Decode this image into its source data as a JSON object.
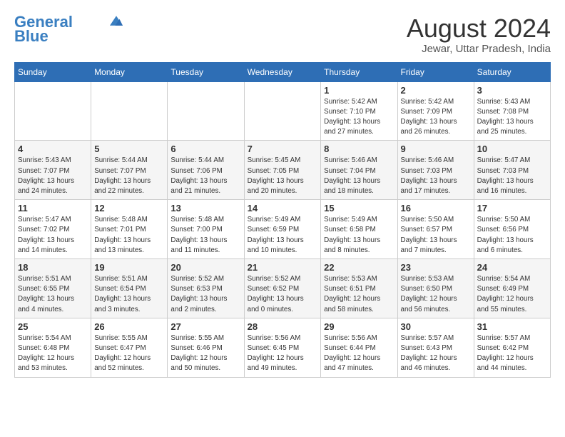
{
  "header": {
    "logo_line1": "General",
    "logo_line2": "Blue",
    "month": "August 2024",
    "location": "Jewar, Uttar Pradesh, India"
  },
  "days_of_week": [
    "Sunday",
    "Monday",
    "Tuesday",
    "Wednesday",
    "Thursday",
    "Friday",
    "Saturday"
  ],
  "weeks": [
    [
      {
        "day": "",
        "info": ""
      },
      {
        "day": "",
        "info": ""
      },
      {
        "day": "",
        "info": ""
      },
      {
        "day": "",
        "info": ""
      },
      {
        "day": "1",
        "info": "Sunrise: 5:42 AM\nSunset: 7:10 PM\nDaylight: 13 hours\nand 27 minutes."
      },
      {
        "day": "2",
        "info": "Sunrise: 5:42 AM\nSunset: 7:09 PM\nDaylight: 13 hours\nand 26 minutes."
      },
      {
        "day": "3",
        "info": "Sunrise: 5:43 AM\nSunset: 7:08 PM\nDaylight: 13 hours\nand 25 minutes."
      }
    ],
    [
      {
        "day": "4",
        "info": "Sunrise: 5:43 AM\nSunset: 7:07 PM\nDaylight: 13 hours\nand 24 minutes."
      },
      {
        "day": "5",
        "info": "Sunrise: 5:44 AM\nSunset: 7:07 PM\nDaylight: 13 hours\nand 22 minutes."
      },
      {
        "day": "6",
        "info": "Sunrise: 5:44 AM\nSunset: 7:06 PM\nDaylight: 13 hours\nand 21 minutes."
      },
      {
        "day": "7",
        "info": "Sunrise: 5:45 AM\nSunset: 7:05 PM\nDaylight: 13 hours\nand 20 minutes."
      },
      {
        "day": "8",
        "info": "Sunrise: 5:46 AM\nSunset: 7:04 PM\nDaylight: 13 hours\nand 18 minutes."
      },
      {
        "day": "9",
        "info": "Sunrise: 5:46 AM\nSunset: 7:03 PM\nDaylight: 13 hours\nand 17 minutes."
      },
      {
        "day": "10",
        "info": "Sunrise: 5:47 AM\nSunset: 7:03 PM\nDaylight: 13 hours\nand 16 minutes."
      }
    ],
    [
      {
        "day": "11",
        "info": "Sunrise: 5:47 AM\nSunset: 7:02 PM\nDaylight: 13 hours\nand 14 minutes."
      },
      {
        "day": "12",
        "info": "Sunrise: 5:48 AM\nSunset: 7:01 PM\nDaylight: 13 hours\nand 13 minutes."
      },
      {
        "day": "13",
        "info": "Sunrise: 5:48 AM\nSunset: 7:00 PM\nDaylight: 13 hours\nand 11 minutes."
      },
      {
        "day": "14",
        "info": "Sunrise: 5:49 AM\nSunset: 6:59 PM\nDaylight: 13 hours\nand 10 minutes."
      },
      {
        "day": "15",
        "info": "Sunrise: 5:49 AM\nSunset: 6:58 PM\nDaylight: 13 hours\nand 8 minutes."
      },
      {
        "day": "16",
        "info": "Sunrise: 5:50 AM\nSunset: 6:57 PM\nDaylight: 13 hours\nand 7 minutes."
      },
      {
        "day": "17",
        "info": "Sunrise: 5:50 AM\nSunset: 6:56 PM\nDaylight: 13 hours\nand 6 minutes."
      }
    ],
    [
      {
        "day": "18",
        "info": "Sunrise: 5:51 AM\nSunset: 6:55 PM\nDaylight: 13 hours\nand 4 minutes."
      },
      {
        "day": "19",
        "info": "Sunrise: 5:51 AM\nSunset: 6:54 PM\nDaylight: 13 hours\nand 3 minutes."
      },
      {
        "day": "20",
        "info": "Sunrise: 5:52 AM\nSunset: 6:53 PM\nDaylight: 13 hours\nand 2 minutes."
      },
      {
        "day": "21",
        "info": "Sunrise: 5:52 AM\nSunset: 6:52 PM\nDaylight: 13 hours\nand 0 minutes."
      },
      {
        "day": "22",
        "info": "Sunrise: 5:53 AM\nSunset: 6:51 PM\nDaylight: 12 hours\nand 58 minutes."
      },
      {
        "day": "23",
        "info": "Sunrise: 5:53 AM\nSunset: 6:50 PM\nDaylight: 12 hours\nand 56 minutes."
      },
      {
        "day": "24",
        "info": "Sunrise: 5:54 AM\nSunset: 6:49 PM\nDaylight: 12 hours\nand 55 minutes."
      }
    ],
    [
      {
        "day": "25",
        "info": "Sunrise: 5:54 AM\nSunset: 6:48 PM\nDaylight: 12 hours\nand 53 minutes."
      },
      {
        "day": "26",
        "info": "Sunrise: 5:55 AM\nSunset: 6:47 PM\nDaylight: 12 hours\nand 52 minutes."
      },
      {
        "day": "27",
        "info": "Sunrise: 5:55 AM\nSunset: 6:46 PM\nDaylight: 12 hours\nand 50 minutes."
      },
      {
        "day": "28",
        "info": "Sunrise: 5:56 AM\nSunset: 6:45 PM\nDaylight: 12 hours\nand 49 minutes."
      },
      {
        "day": "29",
        "info": "Sunrise: 5:56 AM\nSunset: 6:44 PM\nDaylight: 12 hours\nand 47 minutes."
      },
      {
        "day": "30",
        "info": "Sunrise: 5:57 AM\nSunset: 6:43 PM\nDaylight: 12 hours\nand 46 minutes."
      },
      {
        "day": "31",
        "info": "Sunrise: 5:57 AM\nSunset: 6:42 PM\nDaylight: 12 hours\nand 44 minutes."
      }
    ]
  ]
}
